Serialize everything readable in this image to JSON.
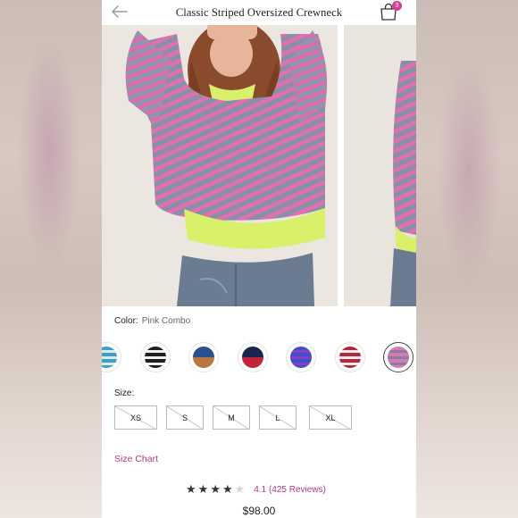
{
  "header": {
    "title": "Classic Striped Oversized Crewneck",
    "cart_count": "3"
  },
  "product": {
    "color_label": "Color:",
    "color_value": "Pink Combo",
    "size_label": "Size:",
    "sizes": [
      "XS",
      "S",
      "M",
      "L",
      "XL"
    ],
    "size_chart_label": "Size Chart",
    "rating_value": 4.1,
    "stars_filled": 4,
    "stars_total": 5,
    "rating_text": "4.1 (425 Reviews)",
    "price": "$98.00"
  },
  "swatches": [
    {
      "name": "teal-stripe",
      "colors": [
        "#38a2c2",
        "#dfe7ea"
      ]
    },
    {
      "name": "black-white-stripe",
      "colors": [
        "#1f1f1f",
        "#f2f0ea"
      ]
    },
    {
      "name": "navy-tan",
      "colors": [
        "#2c4f8f",
        "#b9763e"
      ]
    },
    {
      "name": "navy-red",
      "colors": [
        "#1a2650",
        "#c0243a"
      ]
    },
    {
      "name": "blue-purple-stripe",
      "colors": [
        "#3a4fd6",
        "#8d3fb0"
      ]
    },
    {
      "name": "red-white-stripe",
      "colors": [
        "#b3293b",
        "#f5ecea"
      ]
    },
    {
      "name": "pink-combo",
      "colors": [
        "#d37cb0",
        "#8d7aa4"
      ],
      "selected": true
    }
  ],
  "colors": {
    "accent": "#b03a7c",
    "badge": "#d4408f",
    "stripe_pink": "#e26fb0",
    "stripe_slate": "#8a8fa8",
    "hem_lime": "#d9f06a"
  }
}
